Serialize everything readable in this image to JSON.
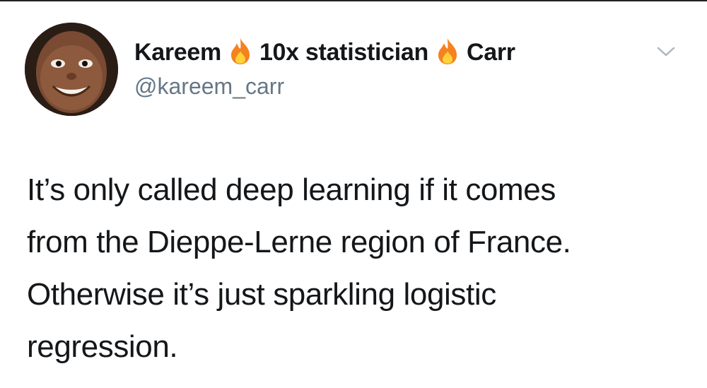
{
  "author": {
    "name_first": "Kareem",
    "name_middle": "10x statistician",
    "name_last": "Carr",
    "handle": "@kareem_carr"
  },
  "icons": {
    "name_emoji": "fire-icon",
    "menu": "chevron-down-icon"
  },
  "tweet": {
    "lines": [
      "It’s only called deep learning if it comes",
      "from the Dieppe-Lerne region of France.",
      "Otherwise it’s just sparkling logistic",
      "regression."
    ]
  },
  "colors": {
    "text": "#14171a",
    "handle": "#657786",
    "chevron": "#aab8c2",
    "fire_outer": "#f5821f",
    "fire_inner": "#ffd23a"
  }
}
